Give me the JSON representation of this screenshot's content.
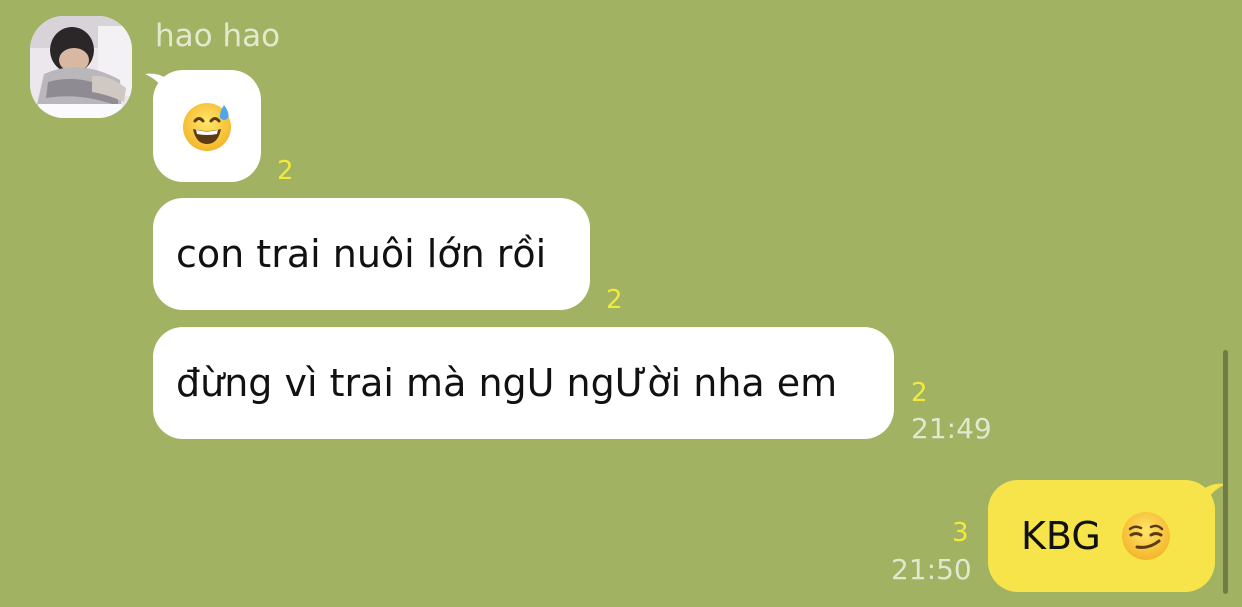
{
  "sender": {
    "name": "hao hao"
  },
  "messages": [
    {
      "kind": "emoji",
      "icon": "grinning-face-with-sweat-emoji",
      "unread": "2"
    },
    {
      "kind": "text",
      "text": "con trai nuôi lớn rồi",
      "unread": "2"
    },
    {
      "kind": "text",
      "text": "đừng vì trai mà ngU ngƯời nha em",
      "unread": "2",
      "time": "21:49"
    },
    {
      "kind": "text",
      "text": "KBG",
      "icon": "smirking-face-emoji",
      "unread": "3",
      "time": "21:50"
    }
  ],
  "colors": {
    "background": "#a1b262",
    "incoming_bubble": "#ffffff",
    "outgoing_bubble": "#f7e44a",
    "unread_count": "#f3ea3a",
    "timestamp": "#e2e7cf"
  }
}
